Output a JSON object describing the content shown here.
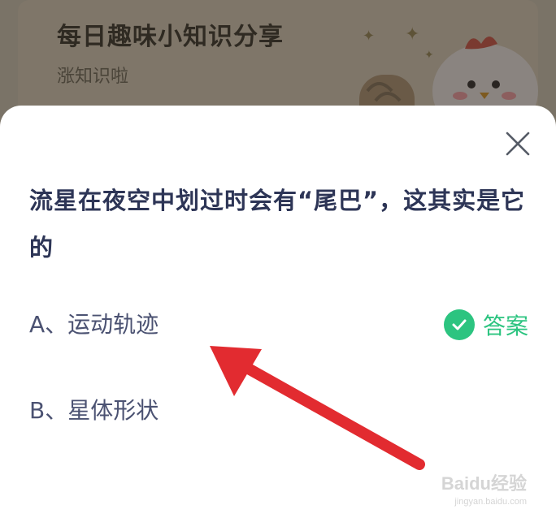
{
  "banner": {
    "title": "每日趣味小知识分享",
    "subtitle": "涨知识啦"
  },
  "quiz": {
    "question": "流星在夜空中划过时会有“尾巴”，这其实是它的",
    "options": [
      {
        "label": "A、运动轨迹"
      },
      {
        "label": "B、星体形状"
      }
    ],
    "answer_label": "答案"
  },
  "watermark": {
    "main": "Baidu经验",
    "sub": "jingyan.baidu.com"
  },
  "colors": {
    "accent_green": "#2cc480",
    "question_text": "#2d3556",
    "arrow_red": "#e22b30"
  },
  "icons": {
    "close": "close-icon",
    "check": "check-circle-icon",
    "mascot": "chicken-mascot-icon",
    "pointer": "red-arrow"
  }
}
